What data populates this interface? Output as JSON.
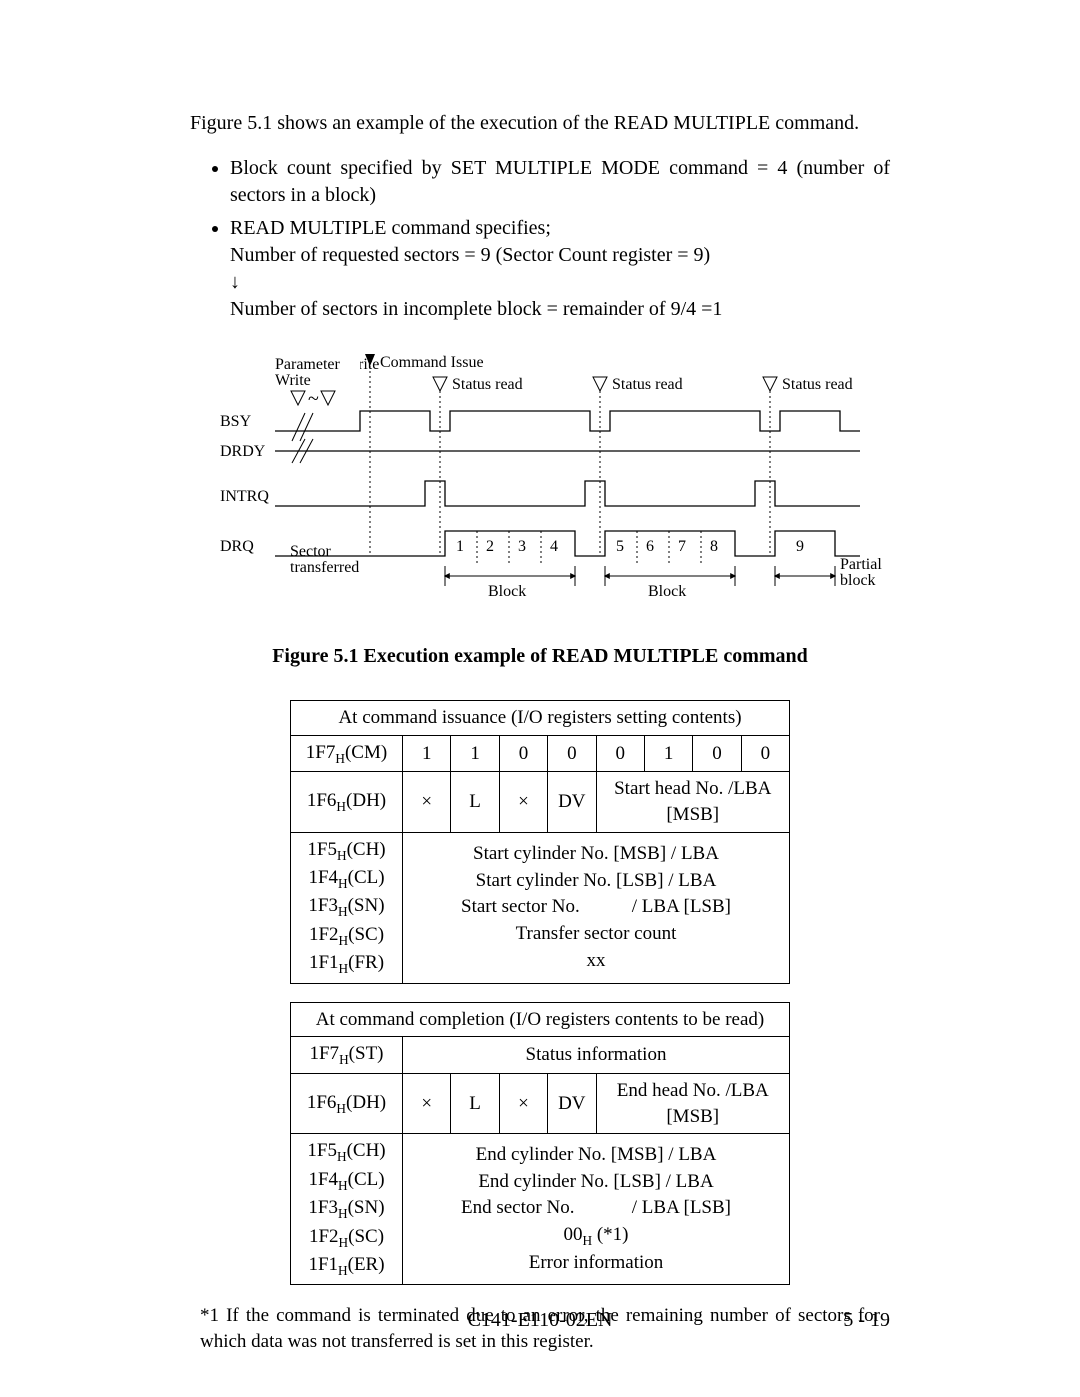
{
  "intro": "Figure 5.1 shows an example of the execution of the READ MULTIPLE command.",
  "bullets": {
    "b1": "Block count specified by SET MULTIPLE MODE command = 4 (number of sectors in a block)",
    "b2": " READ MULTIPLE command specifies;",
    "b2_l1": "Number of requested sectors = 9 (Sector Count register = 9)",
    "b2_arrow": "↓",
    "b2_l2": "Number of sectors in incomplete block = remainder of 9/4 =1"
  },
  "diagram": {
    "param_write": "Parameter Write",
    "cmd_issue": "Command Issue",
    "status_read": "Status read",
    "bsy": "BSY",
    "drdy": "DRDY",
    "intrq": "INTRQ",
    "drq": "DRQ",
    "sector_trans": "Sector transferred",
    "s1": "1",
    "s2": "2",
    "s3": "3",
    "s4": "4",
    "s5": "5",
    "s6": "6",
    "s7": "7",
    "s8": "8",
    "s9": "9",
    "block": "Block",
    "partial_block": "Partial block"
  },
  "fig_caption": "Figure 5.1    Execution example of READ MULTIPLE command",
  "table1": {
    "title": "At command issuance (I/O registers setting contents)",
    "r1_lbl": "1F7",
    "r1_lbls": "H",
    "r1_lblt": "(CM)",
    "r1_b7": "1",
    "r1_b6": "1",
    "r1_b5": "0",
    "r1_b4": "0",
    "r1_b3": "0",
    "r1_b2": "1",
    "r1_b1": "0",
    "r1_b0": "0",
    "r2_lbl": "1F6",
    "r2_lbls": "H",
    "r2_lblt": "(DH)",
    "r2_b7": "×",
    "r2_b6": "L",
    "r2_b5": "×",
    "r2_b4": "DV",
    "r2_rest": "Start head No. /LBA [MSB]",
    "r3_lbl1": "1F5",
    "r3_s1": "H",
    "r3_t1": "(CH)",
    "r3_lbl2": "1F4",
    "r3_s2": "H",
    "r3_t2": "(CL)",
    "r3_lbl3": "1F3",
    "r3_s3": "H",
    "r3_t3": "(SN)",
    "r3_lbl4": "1F2",
    "r3_s4": "H",
    "r3_t4": "(SC)",
    "r3_lbl5": "1F1",
    "r3_s5": "H",
    "r3_t5": "(FR)",
    "r3_d1": "Start cylinder No. [MSB]  / LBA",
    "r3_d2": "Start cylinder No. [LSB]  / LBA",
    "r3_d3l": "Start sector No.",
    "r3_d3r": "/ LBA [LSB]",
    "r3_d4": "Transfer sector count",
    "r3_d5": "xx"
  },
  "table2": {
    "title": "At command completion (I/O registers contents to be read)",
    "r1_lbl": "1F7",
    "r1_lbls": "H",
    "r1_lblt": "(ST)",
    "r1_d": "Status information",
    "r2_lbl": "1F6",
    "r2_lbls": "H",
    "r2_lblt": "(DH)",
    "r2_b7": "×",
    "r2_b6": "L",
    "r2_b5": "×",
    "r2_b4": "DV",
    "r2_rest": "End head No. /LBA [MSB]",
    "r3_lbl1": "1F5",
    "r3_s1": "H",
    "r3_t1": "(CH)",
    "r3_lbl2": "1F4",
    "r3_s2": "H",
    "r3_t2": "(CL)",
    "r3_lbl3": "1F3",
    "r3_s3": "H",
    "r3_t3": "(SN)",
    "r3_lbl4": "1F2",
    "r3_s4": "H",
    "r3_t4": "(SC)",
    "r3_lbl5": "1F1",
    "r3_s5": "H",
    "r3_t5": "(ER)",
    "r3_d1": "End cylinder No. [MSB]  / LBA",
    "r3_d2": "End cylinder No. [LSB]   / LBA",
    "r3_d3l": "End sector No.",
    "r3_d3r": "/ LBA [LSB]",
    "r3_d4a": "00",
    "r3_d4b": "H",
    "r3_d4c": " (*1)",
    "r3_d5": "Error information"
  },
  "footnote": "*1  If the command is terminated due to an error, the remaining number of sectors for which data was not transferred is set in this register.",
  "footer_center": "C141-E110-02EN",
  "footer_right": "5 - 19"
}
